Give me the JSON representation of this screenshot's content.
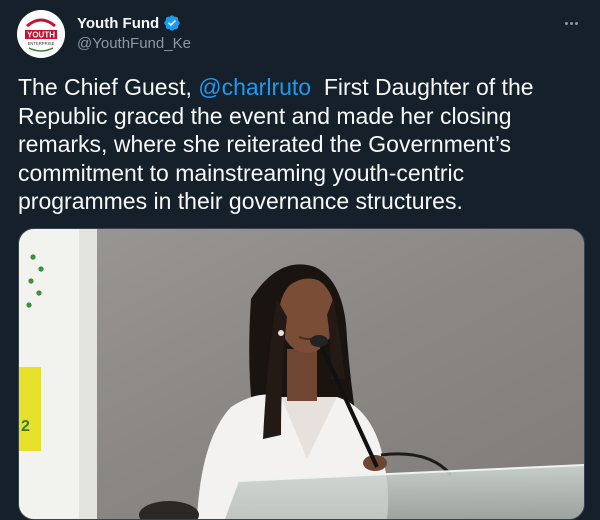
{
  "account": {
    "display_name": "Youth Fund",
    "handle": "@YouthFund_Ke",
    "avatar_icon": "youth-enterprise-logo",
    "avatar_logo_text": "YOUTH",
    "avatar_logo_subtext": "ENTERPRISE",
    "verified": true,
    "verified_color": "#1d9bf0"
  },
  "tweet": {
    "text_before": "The Chief Guest, ",
    "mention": "@charlruto",
    "text_after": "  First Daughter of the Republic graced the event and made her closing remarks, where she reiterated the Government’s commitment to mainstreaming youth-centric programmes in their governance structures."
  },
  "media": {
    "image_icon": "speaker-at-podium-photo",
    "backdrop_label": "2"
  },
  "colors": {
    "background": "#15202b",
    "text": "#f7f9f9",
    "secondary_text": "#8b98a5",
    "link": "#1d9bf0"
  }
}
